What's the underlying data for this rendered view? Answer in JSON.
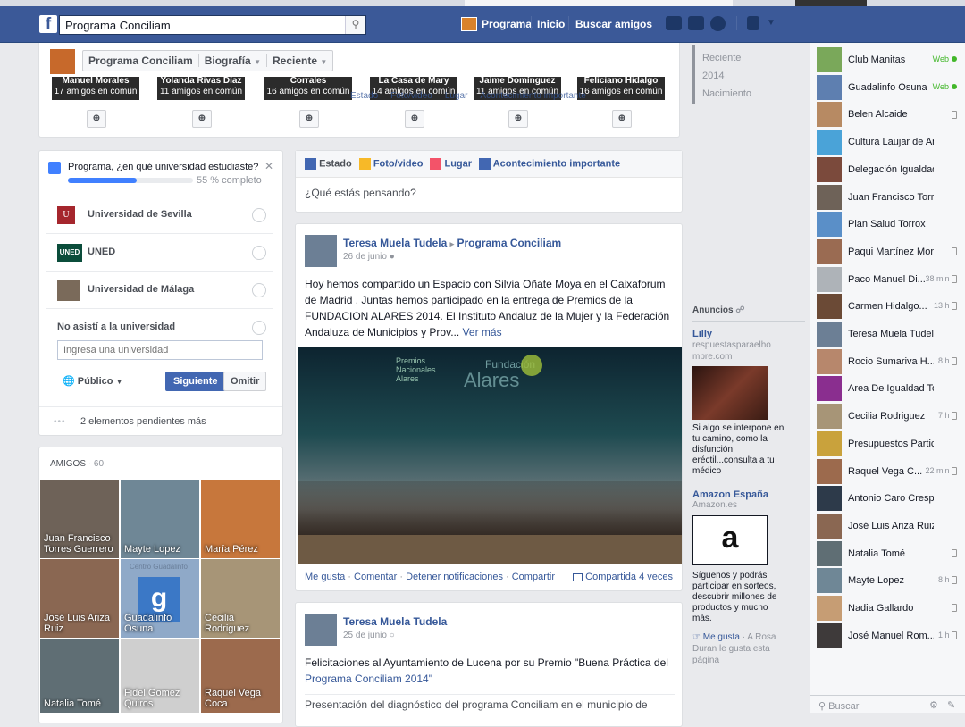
{
  "topbar": {
    "search_value": "Programa Conciliam",
    "nav": [
      "Programa",
      "Inicio",
      "Buscar amigos"
    ]
  },
  "profile_header": {
    "page_name": "Programa Conciliam",
    "biografia_label": "Biografía",
    "reciente_label": "Reciente"
  },
  "suggestions": [
    {
      "name": "Manuel Morales",
      "mutual": "17 amigos en común"
    },
    {
      "name": "Yolanda Rivas Díaz",
      "mutual": "11 amigos en común"
    },
    {
      "name": "Corrales",
      "mutual": "16 amigos en común"
    },
    {
      "name": "La Casa de Mary",
      "mutual": "14 amigos en común"
    },
    {
      "name": "Jaime Domínguez",
      "mutual": "11 amigos en común"
    },
    {
      "name": "Feliciano Hidalgo",
      "mutual": "16 amigos en común"
    }
  ],
  "ghost_composer": [
    "Estado",
    "Foto/video",
    "Lugar",
    "Acontecimiento importante"
  ],
  "timeline_nav": [
    "Reciente",
    "2014",
    "Nacimiento"
  ],
  "education": {
    "question": "Programa, ¿en qué universidad estudiaste?",
    "progress_text": "55 % completo",
    "progress": 0.55,
    "options": [
      "Universidad de Sevilla",
      "UNED",
      "Universidad de Málaga",
      "No asistí a la universidad"
    ],
    "uned_logo_text": "UNED",
    "input_placeholder": "Ingresa una universidad",
    "privacy": "Público",
    "next": "Siguiente",
    "skip": "Omitir",
    "pending": "2 elementos pendientes más",
    "pending_dots": "•••",
    "close_glyph": "✕"
  },
  "friends": {
    "label": "AMIGOS",
    "count_sep": "·",
    "count": "60",
    "list": [
      {
        "name": "Juan Francisco Torres Guerrero",
        "color": "#6e6258"
      },
      {
        "name": "Mayte Lopez",
        "color": "#6f8796"
      },
      {
        "name": "María Pérez",
        "color": "#c7773c"
      },
      {
        "name": "José Luis Ariza Ruiz",
        "color": "#8a6752"
      },
      {
        "name": "Guadalinfo Osuna",
        "color": "#8fa9c8"
      },
      {
        "name": "Cecilia Rodriguez",
        "color": "#a79577"
      },
      {
        "name": "Natalia Tomé",
        "color": "#5f6e74"
      },
      {
        "name": "Fidel Gomez Quiros",
        "color": "#cfcfcf"
      },
      {
        "name": "Raquel Vega Coca",
        "color": "#9c6a4d"
      }
    ],
    "guadalinfo_banner": "Centro Guadalinfo"
  },
  "composer": {
    "tabs": [
      "Estado",
      "Foto/video",
      "Lugar",
      "Acontecimiento importante"
    ],
    "placeholder": "¿Qué estás pensando?"
  },
  "post1": {
    "author": "Teresa Muela Tudela",
    "arrow": "▸",
    "target": "Programa Conciliam",
    "date": "26 de junio",
    "text": "Hoy hemos compartido un Espacio con Silvia Oñate Moya en el Caixaforum de Madrid . Juntas hemos participado en la entrega de Premios de la FUNDACION ALARES 2014. El Instituto Andaluz de la Mujer y la Federación Andaluza de Municipios y Prov...",
    "more": "Ver más",
    "photo_banner": "Premios Nacionales Alares",
    "photo_brand": "Alares",
    "photo_fundacion": "Fundación",
    "actions": [
      "Me gusta",
      "Comentar",
      "Detener notificaciones",
      "Compartir"
    ],
    "shared": "Compartida 4 veces"
  },
  "post2": {
    "author": "Teresa Muela Tudela",
    "date": "25 de junio",
    "text": "Felicitaciones al Ayuntamiento de Lucena por su Premio \"Buena Práctica del",
    "link": "Programa Conciliam 2014\"",
    "text2": "Presentación del diagnóstico del programa Conciliam en el municipio de"
  },
  "ads": {
    "header": "Anuncios",
    "ad1": {
      "title": "Lilly",
      "domain": "respuestasparaelhombre.com",
      "body": "Si algo se interpone en tu camino, como la disfunción eréctil...consulta a tu médico"
    },
    "ad2": {
      "title": "Amazon España",
      "domain": "Amazon.es",
      "logo": "a",
      "body": "Síguenos y podrás participar en sorteos, descubrir millones de productos y mucho más.",
      "like": "Me gusta",
      "like_sep": "·",
      "social": "A Rosa Duran le gusta esta página"
    }
  },
  "chat": {
    "web_label": "Web",
    "search_placeholder": "Buscar",
    "contacts": [
      {
        "name": "Club Manitas",
        "status": "Web",
        "type": "web",
        "color": "#7aa85a"
      },
      {
        "name": "Guadalinfo Osuna",
        "status": "Web",
        "type": "web",
        "color": "#5e7fb0"
      },
      {
        "name": "Belen Alcaide",
        "status": "",
        "type": "mobile",
        "color": "#b78a63"
      },
      {
        "name": "Cultura Laujar de Andarax",
        "status": "",
        "type": "none",
        "color": "#4aa3d8"
      },
      {
        "name": "Delegación Igualdad",
        "status": "",
        "type": "none",
        "color": "#7b4a3c"
      },
      {
        "name": "Juan Francisco Torres G...",
        "status": "",
        "type": "none",
        "color": "#6e6258"
      },
      {
        "name": "Plan Salud Torrox",
        "status": "",
        "type": "none",
        "color": "#5a8fc8"
      },
      {
        "name": "Paqui Martínez Moreno",
        "status": "",
        "type": "mobile",
        "color": "#9a6b52"
      },
      {
        "name": "Paco Manuel Di...",
        "status": "38 min",
        "type": "mobile",
        "color": "#aeb3b8"
      },
      {
        "name": "Carmen Hidalgo...",
        "status": "13 h",
        "type": "mobile",
        "color": "#6b4a36"
      },
      {
        "name": "Teresa Muela Tudela",
        "status": "",
        "type": "none",
        "color": "#6c7f95"
      },
      {
        "name": "Rocio Sumariva H...",
        "status": "8 h",
        "type": "mobile",
        "color": "#b7876c"
      },
      {
        "name": "Area De Igualdad Torrox",
        "status": "",
        "type": "none",
        "color": "#8a2e8f"
      },
      {
        "name": "Cecilia Rodriguez",
        "status": "7 h",
        "type": "mobile",
        "color": "#a79577"
      },
      {
        "name": "Presupuestos Participativ...",
        "status": "",
        "type": "none",
        "color": "#c9a23c"
      },
      {
        "name": "Raquel Vega C...",
        "status": "22 min",
        "type": "mobile",
        "color": "#9c6a4d"
      },
      {
        "name": "Antonio Caro Crespo",
        "status": "",
        "type": "none",
        "color": "#2d3a4a"
      },
      {
        "name": "José Luis Ariza Ruiz",
        "status": "",
        "type": "none",
        "color": "#8a6752"
      },
      {
        "name": "Natalia Tomé",
        "status": "",
        "type": "mobile",
        "color": "#5f6e74"
      },
      {
        "name": "Mayte Lopez",
        "status": "8 h",
        "type": "mobile",
        "color": "#6f8796"
      },
      {
        "name": "Nadia Gallardo",
        "status": "",
        "type": "mobile",
        "color": "#c69d74"
      },
      {
        "name": "José Manuel Rom...",
        "status": "1 h",
        "type": "mobile",
        "color": "#3e3a3a"
      }
    ]
  },
  "colors": {
    "brand": "#3b5998",
    "link": "#365899",
    "progress": "#4080ff"
  }
}
